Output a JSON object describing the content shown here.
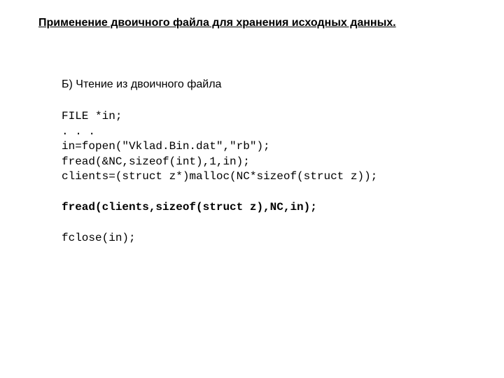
{
  "title": "Применение двоичного файла для хранения исходных данных.",
  "subtitle": "Б) Чтение из двоичного файла",
  "lines": {
    "l1": "FILE *in;",
    "l2": ". . .",
    "l3": "in=fopen(\"Vklad.Bin.dat\",\"rb\");",
    "l4": "fread(&NC,sizeof(int),1,in);",
    "l5": "clients=(struct z*)malloc(NC*sizeof(struct z));",
    "l6": "fread(clients,sizeof(struct z),NC,in);",
    "l7": "fclose(in);"
  }
}
